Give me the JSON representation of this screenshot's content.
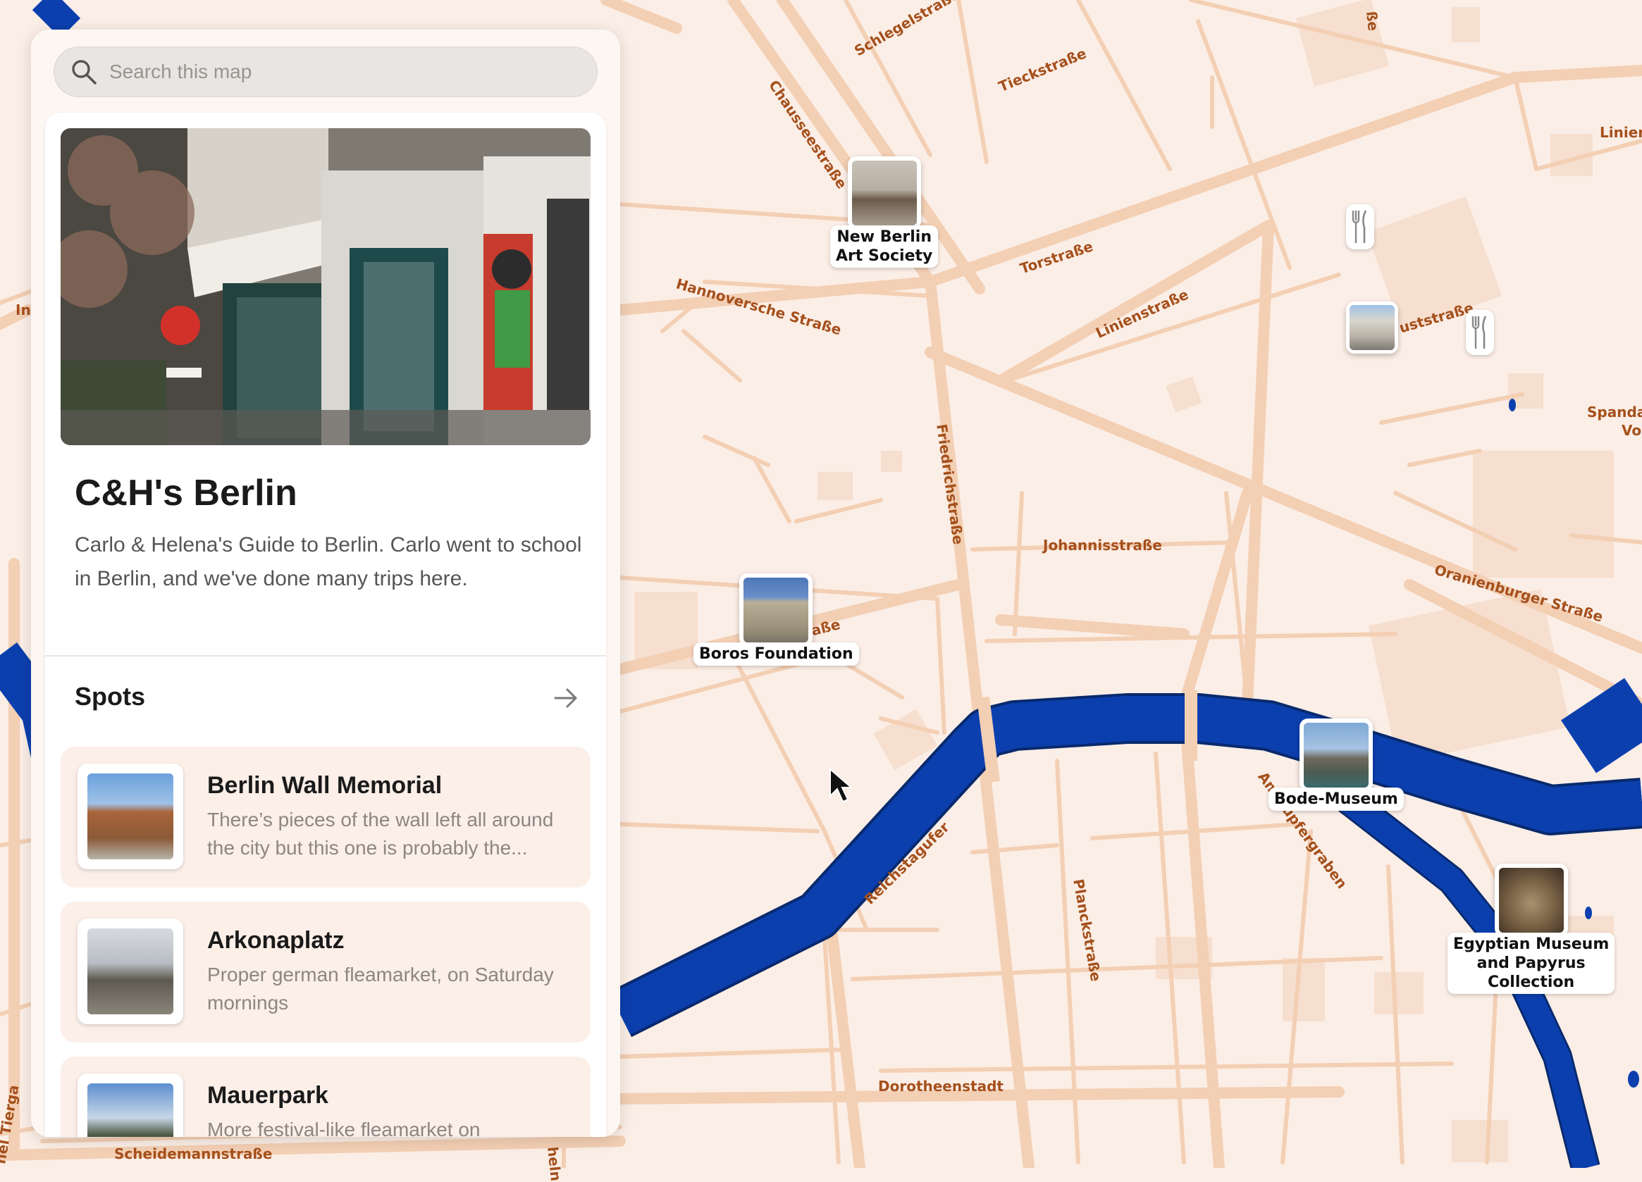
{
  "search": {
    "placeholder": "Search this map"
  },
  "guide": {
    "title": "C&H's Berlin",
    "description": "Carlo & Helena's Guide to Berlin. Carlo went to school in Berlin, and we've done many trips here.",
    "spots_heading": "Spots"
  },
  "spots": [
    {
      "title": "Berlin Wall Memorial",
      "description": "There’s pieces of the wall left all around the city but this one is probably the..."
    },
    {
      "title": "Arkonaplatz",
      "description": "Proper german fleamarket, on Saturday mornings"
    },
    {
      "title": "Mauerpark",
      "description": "More festival-like fleamarket on"
    }
  ],
  "map": {
    "markers": [
      {
        "name": "New Berlin\nArt Society"
      },
      {
        "name": "Boros Foundation"
      },
      {
        "name": "Bode-Museum"
      },
      {
        "name": "Egyptian Museum\nand Papyrus\nCollection"
      }
    ],
    "streets": [
      "Schlegelstraße",
      "Tieckstraße",
      "Chausseestraße",
      "Hannoversche Straße",
      "Torstraße",
      "Linienstraße",
      "uststraße",
      "Friedrichstraße",
      "Johannisstraße",
      "Oranienburger Straße",
      "raße",
      "Reichstagufer",
      "Am Kupfergraben",
      "Planckstraße",
      "Dorotheenstadt",
      "Scheidemannstraße",
      "Linien",
      "Spandauer\nVorsta",
      "ße",
      "Inv",
      "nel Tierga",
      "heln"
    ],
    "colors": {
      "land": "#fbeee6",
      "road": "#f3cfb4",
      "water": "#0c3fae",
      "label": "#a5501c"
    },
    "icons": {
      "restaurant": "fork-knife-icon"
    }
  }
}
